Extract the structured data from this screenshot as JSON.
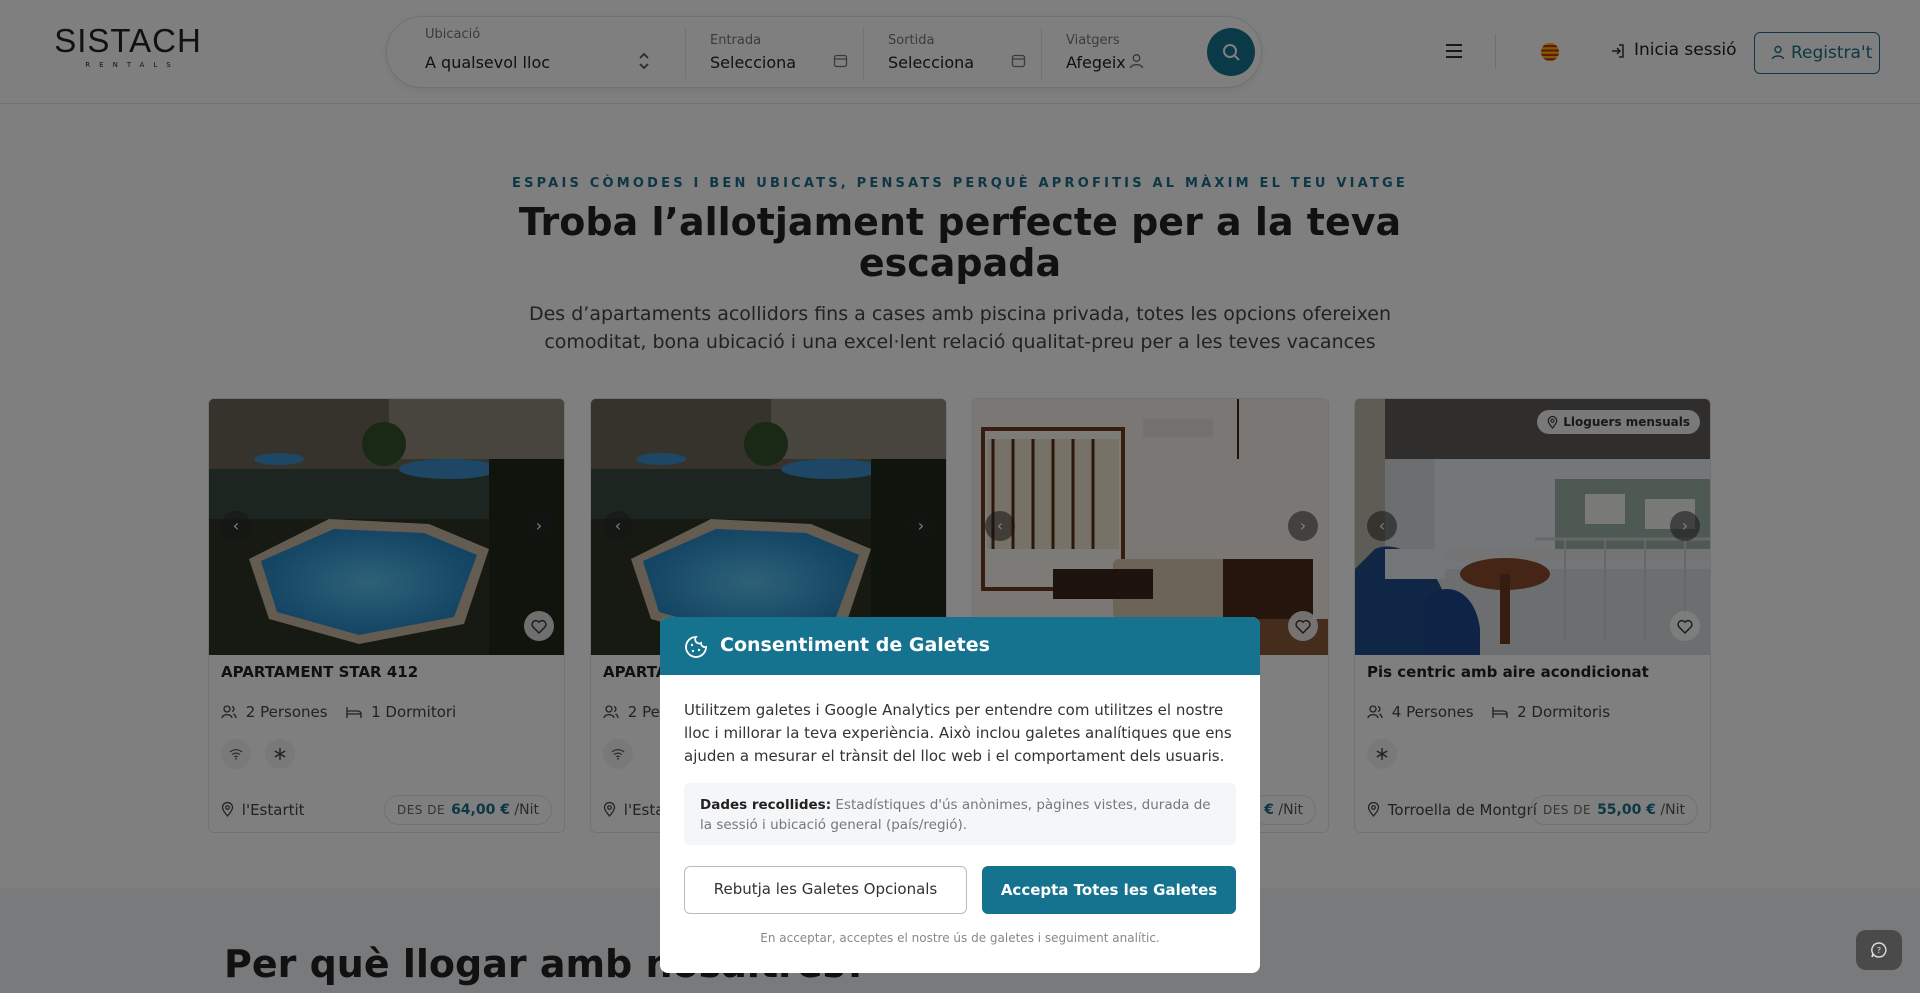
{
  "brand": {
    "name": "SISTACH",
    "tagline": "RENTALS"
  },
  "search": {
    "location": {
      "label": "Ubicació",
      "value": "A qualsevol lloc"
    },
    "checkin": {
      "label": "Entrada",
      "value": "Selecciona"
    },
    "checkout": {
      "label": "Sortida",
      "value": "Selecciona"
    },
    "guests": {
      "label": "Viatgers",
      "value": "Afegeix"
    }
  },
  "header": {
    "login_label": "Inicia sessió",
    "register_label": "Registra't"
  },
  "hero": {
    "eyebrow": "ESPAIS CÒMODES I BEN UBICATS, PENSATS PERQUÈ APROFITIS AL MÀXIM EL TEU VIATGE",
    "title": "Troba l’allotjament perfecte per a la teva escapada",
    "subtitle": "Des d’apartaments acollidors fins a cases amb piscina privada, totes les opcions ofereixen comoditat, bona ubicació i una excel·lent relació qualitat-preu per a les teves vacances"
  },
  "listings": [
    {
      "title": "APARTAMENT STAR 412",
      "persons": "2 Persones",
      "rooms": "1 Dormitori",
      "location": "l'Estartit",
      "price_prefix": "DES DE",
      "price": "64,00 €",
      "unit": "/Nit",
      "badge": ""
    },
    {
      "title": "APARTA",
      "persons": "2 Per",
      "rooms": "",
      "location": "l'Esta",
      "price_prefix": "",
      "price": "",
      "unit": "",
      "badge": ""
    },
    {
      "title": "",
      "persons": "",
      "rooms": "",
      "location": "",
      "price_prefix": "",
      "price": "€",
      "unit": "/Nit",
      "badge": ""
    },
    {
      "title": "Pis centric amb aire acondicionat",
      "persons": "4 Persones",
      "rooms": "2 Dormitoris",
      "location": "Torroella de Montgrí",
      "price_prefix": "DES DE",
      "price": "55,00 €",
      "unit": "/Nit",
      "badge": "Lloguers mensuals"
    }
  ],
  "section2": {
    "title": "Per què llogar amb nosaltres?"
  },
  "cookie_modal": {
    "title": "Consentiment de Galetes",
    "body": "Utilitzem galetes i Google Analytics per entendre com utilitzes el nostre lloc i millorar la teva experiència. Això inclou galetes analítiques que ens ajuden a mesurar el trànsit del lloc web i el comportament dels usuaris.",
    "data_label": "Dades recollides:",
    "data_text": "Estadístiques d'ús anònimes, pàgines vistes, durada de la sessió i ubicació general (país/regió).",
    "reject_label": "Rebutja les Galetes Opcionals",
    "accept_label": "Accepta Totes les Galetes",
    "footnote": "En acceptar, acceptes el nostre ús de galetes i seguiment analític."
  },
  "colors": {
    "accent": "#15738f",
    "overlay": "rgba(0,0,0,0.5)"
  }
}
